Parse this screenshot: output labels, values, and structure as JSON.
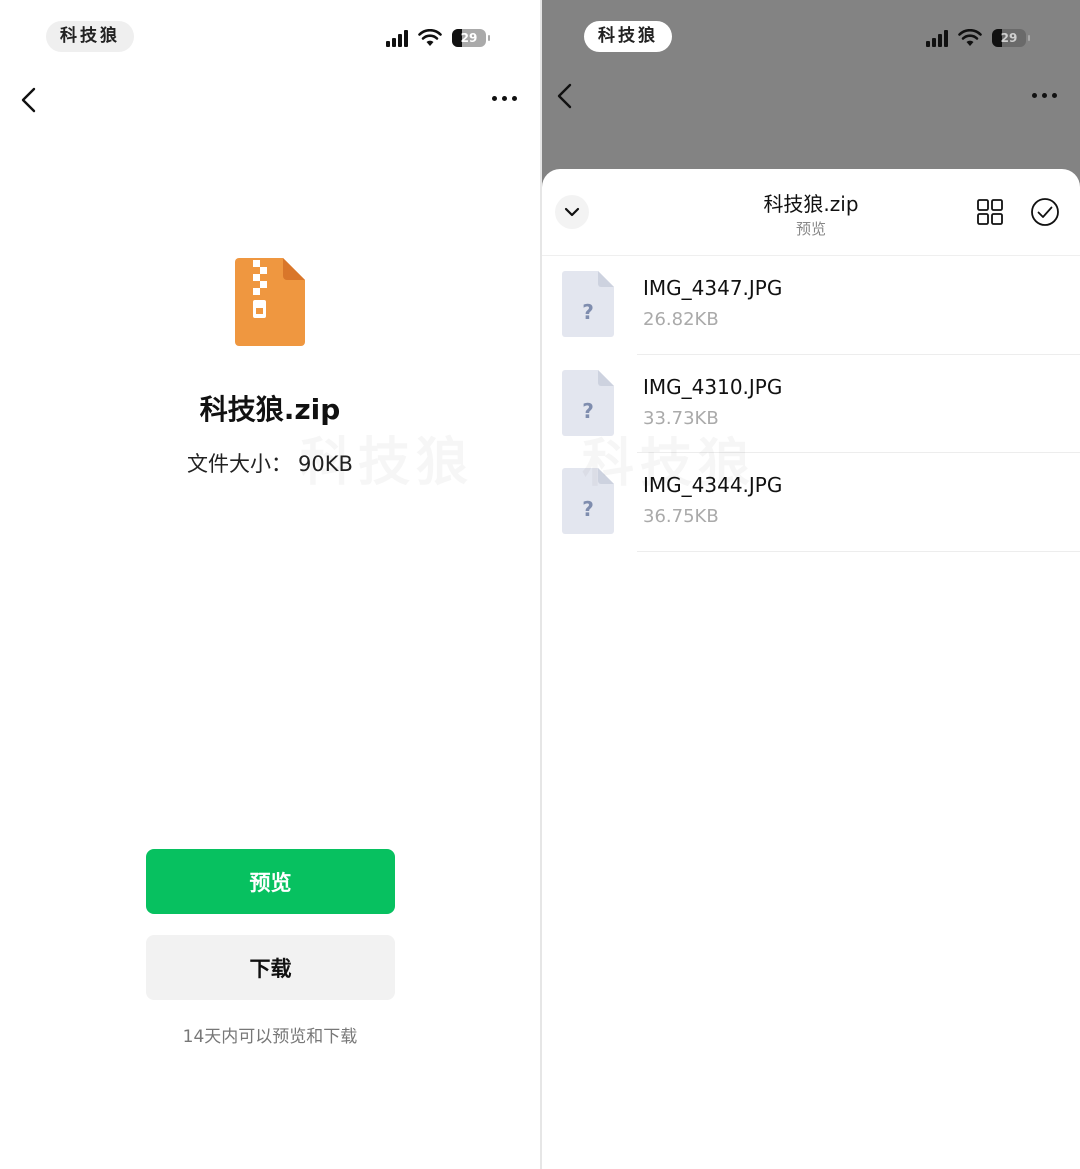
{
  "left": {
    "status_bar": {
      "carrier": "科技狼",
      "battery": "29"
    },
    "file": {
      "name": "科技狼.zip",
      "size_label": "文件大小：",
      "size_value": "90KB"
    },
    "buttons": {
      "preview": "预览",
      "download": "下载"
    },
    "note": "14天内可以预览和下载",
    "watermark": "科技狼"
  },
  "right": {
    "status_bar": {
      "carrier": "科技狼",
      "battery": "29"
    },
    "sheet": {
      "title": "科技狼.zip",
      "subtitle": "预览"
    },
    "files": [
      {
        "name": "IMG_4347.JPG",
        "size": "26.82KB"
      },
      {
        "name": "IMG_4310.JPG",
        "size": "33.73KB"
      },
      {
        "name": "IMG_4344.JPG",
        "size": "36.75KB"
      }
    ],
    "watermark": "科技狼"
  },
  "colors": {
    "accent_green": "#07c160",
    "zip_orange": "#ef9740",
    "overlay_gray": "#838383",
    "doc_icon_gray": "#e3e6ef",
    "doc_icon_mark": "#7f8dae"
  },
  "icons": {
    "back": "chevron-left-icon",
    "more": "more-dots-icon",
    "zip": "zip-file-icon",
    "collapse": "chevron-down-icon",
    "grid": "grid-view-icon",
    "select": "check-circle-icon",
    "unknown_file": "unknown-file-icon"
  }
}
